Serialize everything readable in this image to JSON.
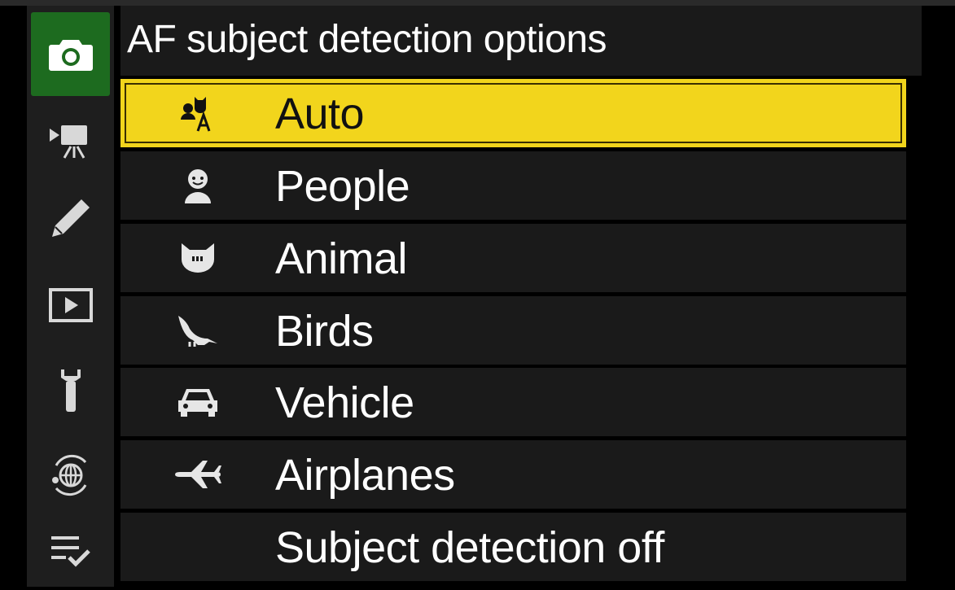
{
  "screen": {
    "title": "AF subject detection options",
    "selected_index": 0
  },
  "sidebar": {
    "tabs": [
      {
        "icon": "camera-icon",
        "active": true
      },
      {
        "icon": "movie-camera-icon",
        "active": false
      },
      {
        "icon": "pencil-icon",
        "active": false
      },
      {
        "icon": "playback-icon",
        "active": false
      },
      {
        "icon": "wrench-icon",
        "active": false
      },
      {
        "icon": "network-icon",
        "active": false
      },
      {
        "icon": "my-menu-icon",
        "active": false
      }
    ]
  },
  "options": [
    {
      "label": "Auto",
      "icon": "auto-subject-icon"
    },
    {
      "label": "People",
      "icon": "person-icon"
    },
    {
      "label": "Animal",
      "icon": "animal-icon"
    },
    {
      "label": "Birds",
      "icon": "bird-icon"
    },
    {
      "label": "Vehicle",
      "icon": "car-icon"
    },
    {
      "label": "Airplanes",
      "icon": "airplane-icon"
    },
    {
      "label": "Subject detection off",
      "icon": ""
    }
  ],
  "colors": {
    "selection": "#f2d51c",
    "active_tab": "#1d6b1f",
    "row_bg": "#1a1a1a"
  }
}
